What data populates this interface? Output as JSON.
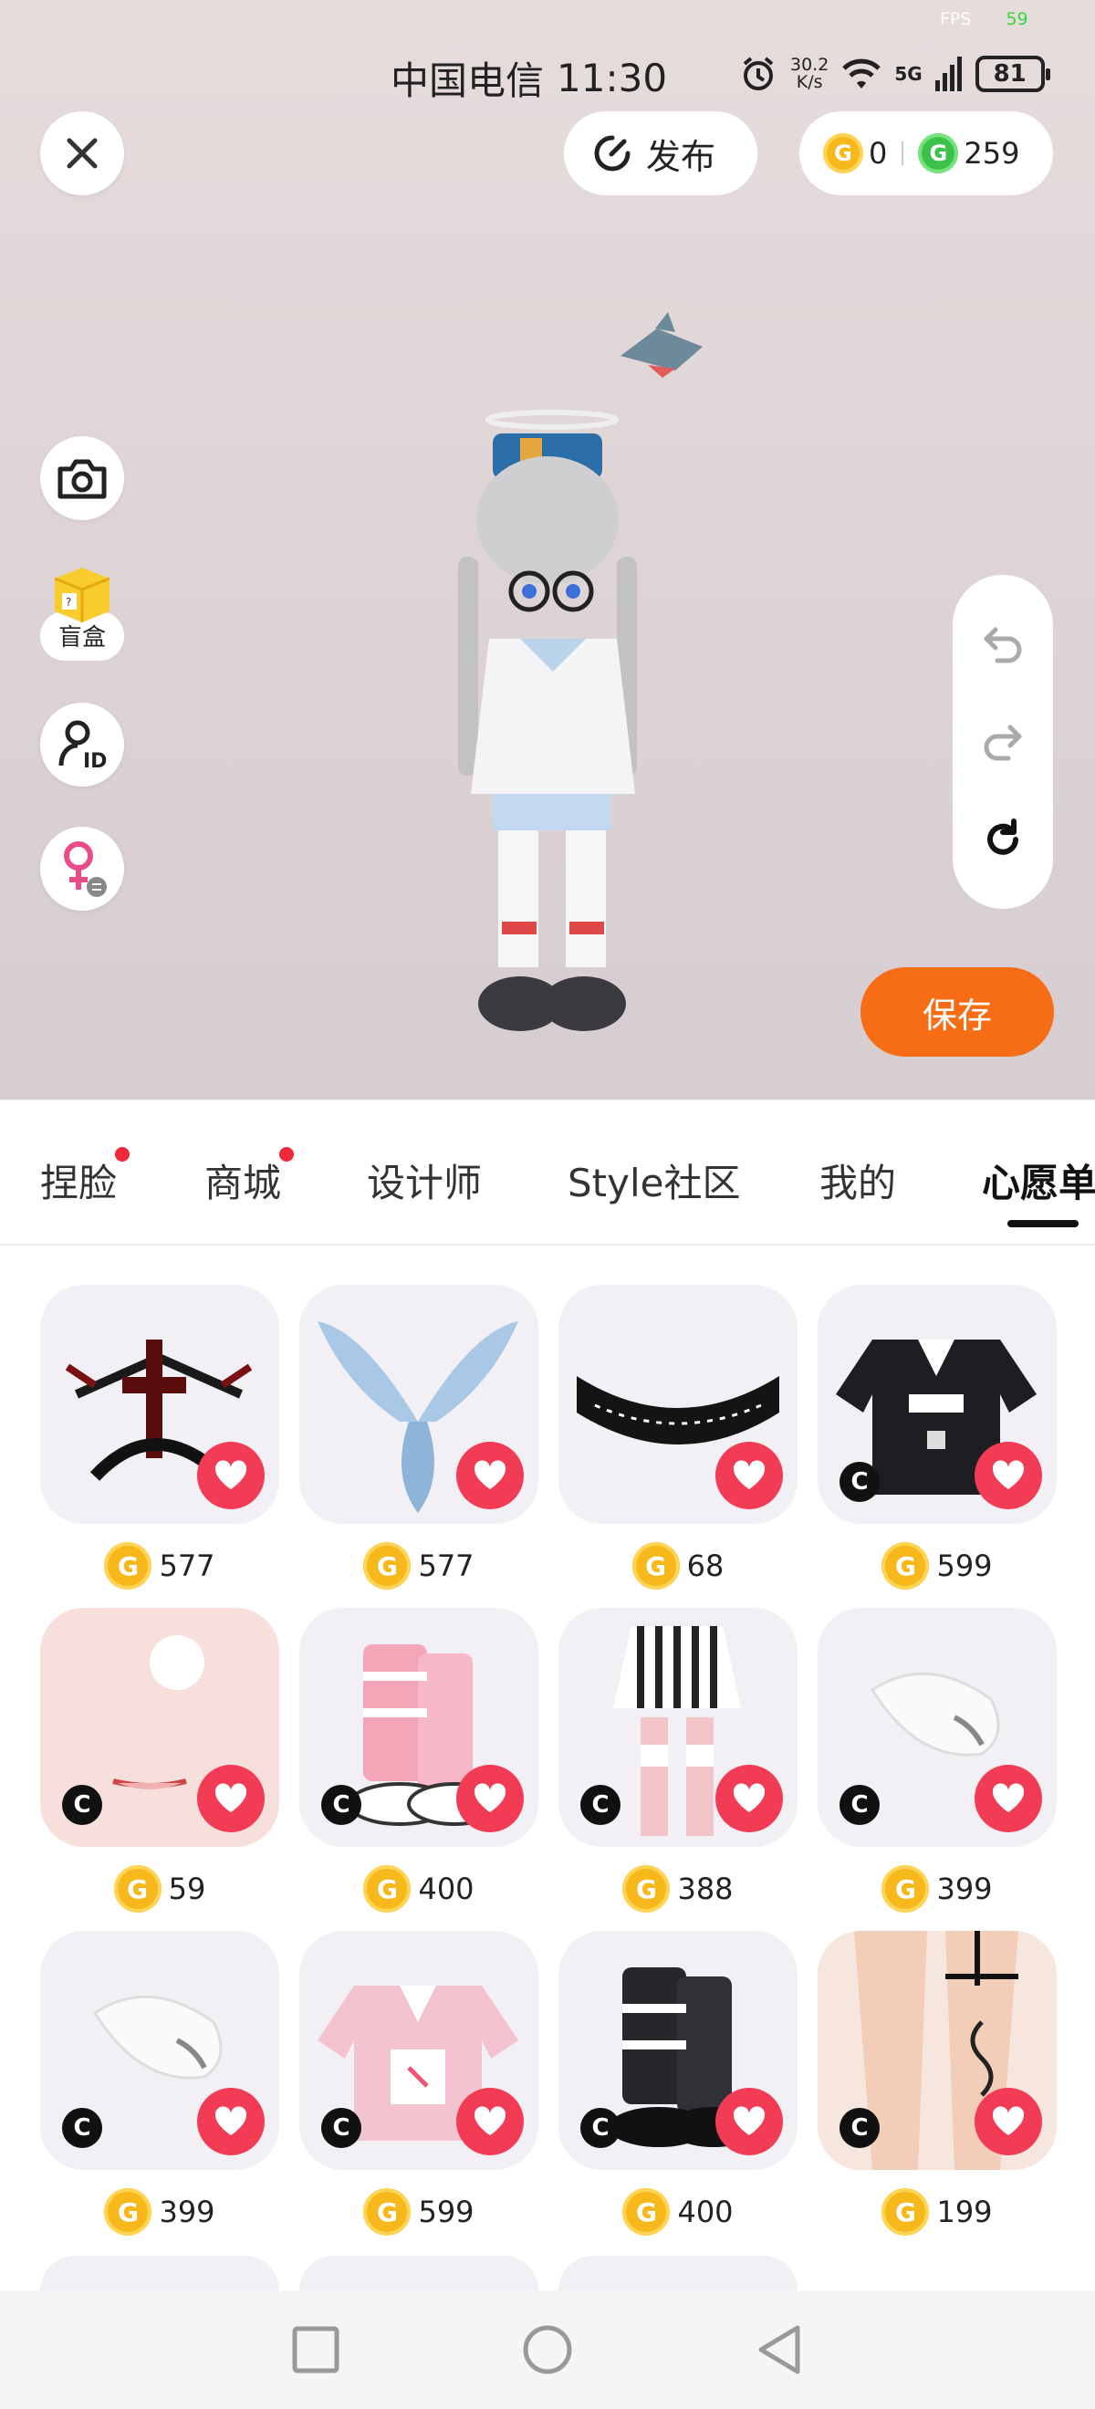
{
  "status_bar": {
    "fps_label": "FPS",
    "fps_value": "59",
    "carrier": "中国电信",
    "time": "11:30",
    "net_speed_value": "30.2",
    "net_speed_unit": "K/s",
    "network": "5G",
    "battery": "81"
  },
  "header": {
    "publish_label": "发布",
    "gold_balance": "0",
    "green_balance": "259"
  },
  "side_tools": {
    "blind_box_label": "盲盒"
  },
  "save_label": "保存",
  "tabs": [
    {
      "label": "捏脸",
      "dot": true
    },
    {
      "label": "商城",
      "dot": true
    },
    {
      "label": "设计师",
      "dot": false
    },
    {
      "label": "Style社区",
      "dot": false
    },
    {
      "label": "我的",
      "dot": false
    },
    {
      "label": "心愿单",
      "dot": false,
      "active": true
    }
  ],
  "items": [
    {
      "name": "dark-cross-wings-effect",
      "price": "577",
      "creator_badge": false,
      "bg": "#f2f0f5",
      "icon": "dark-wings-icon"
    },
    {
      "name": "ice-crystal-wings",
      "price": "577",
      "creator_badge": false,
      "bg": "#f2f0f5",
      "icon": "ice-wings-icon"
    },
    {
      "name": "black-lace-choker",
      "price": "68",
      "creator_badge": false,
      "bg": "#f2f0f5",
      "icon": "lace-choker-icon"
    },
    {
      "name": "black-maid-hoodie",
      "price": "599",
      "creator_badge": true,
      "bg": "#f2f0f5",
      "icon": "black-top-icon"
    },
    {
      "name": "blush-face-makeup",
      "price": "59",
      "creator_badge": true,
      "bg": "#f7dfdb",
      "icon": "face-makeup-icon"
    },
    {
      "name": "pink-striped-boots",
      "price": "400",
      "creator_badge": true,
      "bg": "#f2f0f5",
      "icon": "pink-boots-icon"
    },
    {
      "name": "striped-skirt-outfit",
      "price": "388",
      "creator_badge": true,
      "bg": "#f2f0f5",
      "icon": "striped-skirt-icon"
    },
    {
      "name": "white-fluffy-tail",
      "price": "399",
      "creator_badge": true,
      "bg": "#f2f0f5",
      "icon": "fluffy-tail-icon"
    },
    {
      "name": "white-fluffy-tail-2",
      "price": "399",
      "creator_badge": true,
      "bg": "#f2f0f5",
      "icon": "fluffy-tail-icon"
    },
    {
      "name": "pink-maid-hoodie",
      "price": "599",
      "creator_badge": true,
      "bg": "#f2f0f5",
      "icon": "pink-top-icon"
    },
    {
      "name": "black-striped-boots",
      "price": "400",
      "creator_badge": true,
      "bg": "#f2f0f5",
      "icon": "black-boots-icon"
    },
    {
      "name": "leg-tattoo-garter",
      "price": "199",
      "creator_badge": true,
      "bg": "#f6d4c2",
      "icon": "leg-tattoo-icon"
    }
  ],
  "colors": {
    "accent_orange": "#f76d16",
    "heart_red": "#f23c56",
    "coin_gold": "#f6b81a",
    "coin_green": "#3cc24a"
  }
}
